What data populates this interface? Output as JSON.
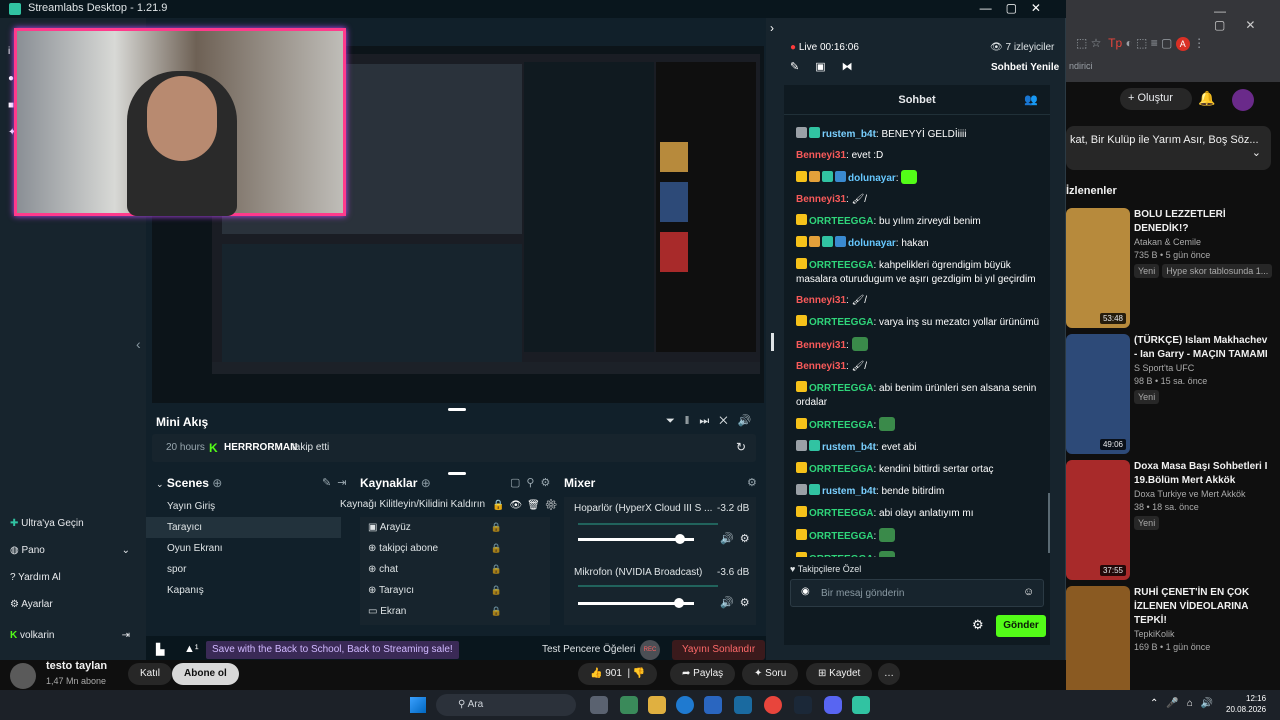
{
  "window": {
    "title": "Streamlabs Desktop - 1.21.9"
  },
  "stream": {
    "live_label": "Live 00:16:06",
    "viewers": "7 izleyiciler",
    "end_chat": "Sohbeti Yenile"
  },
  "chat": {
    "title": "Sohbet",
    "messages": [
      {
        "user": "rustem_b4t",
        "cls": "u-r",
        "text": "BENEYYİ GELDİiiii"
      },
      {
        "user": "Benneyi31",
        "cls": "u-b",
        "text": "evet :D"
      },
      {
        "user": "dolunayar",
        "cls": "u-d",
        "text": ""
      },
      {
        "user": "Benneyi31",
        "cls": "u-b",
        "text": "🖌/"
      },
      {
        "user": "ORRTEEGGA",
        "cls": "u-o",
        "text": "bu yılım zirveydi benim"
      },
      {
        "user": "dolunayar",
        "cls": "u-d",
        "text": "hakan"
      },
      {
        "user": "ORRTEEGGA",
        "cls": "u-o",
        "text": "kahpelikleri ögrendigim büyük masalara oturudugum ve aşırı gezdigim bi yıl geçirdim"
      },
      {
        "user": "Benneyi31",
        "cls": "u-b",
        "text": "🖌/"
      },
      {
        "user": "ORRTEEGGA",
        "cls": "u-o",
        "text": "varya inş su mezatcı yollar ürünümü"
      },
      {
        "user": "Benneyi31",
        "cls": "u-b",
        "text": ""
      },
      {
        "user": "Benneyi31",
        "cls": "u-b",
        "text": "🖌/"
      },
      {
        "user": "ORRTEEGGA",
        "cls": "u-o",
        "text": "abi benim ürünleri sen alsana senin ordalar"
      },
      {
        "user": "ORRTEEGGA",
        "cls": "u-o",
        "text": ""
      },
      {
        "user": "rustem_b4t",
        "cls": "u-r",
        "text": "evet abi"
      },
      {
        "user": "ORRTEEGGA",
        "cls": "u-o",
        "text": "kendini bittirdi sertar ortaç"
      },
      {
        "user": "rustem_b4t",
        "cls": "u-r",
        "text": "bende bitirdim"
      },
      {
        "user": "ORRTEEGGA",
        "cls": "u-o",
        "text": "abi olayı anlatıyım mı"
      },
      {
        "user": "ORRTEEGGA",
        "cls": "u-o",
        "text": ""
      },
      {
        "user": "ORRTEEGGA",
        "cls": "u-o",
        "text": ""
      }
    ],
    "followers_only": "Takipçilere Özel",
    "input_placeholder": "Bir mesaj gönderin",
    "send": "Gönder"
  },
  "mini": {
    "title": "Mini Akış",
    "time": "20 hours",
    "user": "HERRRORMAN",
    "action": "takip etti"
  },
  "scenes": {
    "title": "Scenes",
    "items": [
      "Yayın Giriş",
      "Tarayıcı",
      "Oyun Ekranı",
      "spor",
      "Kapanış"
    ]
  },
  "sources": {
    "title": "Kaynaklar",
    "tooltip": "Kaynağı Kilitleyin/Kilidini Kaldırın",
    "items": [
      "Arayüz",
      "takipçi abone",
      "chat",
      "Tarayıcı",
      "Ekran"
    ]
  },
  "mixer": {
    "title": "Mixer",
    "ch1": {
      "name": "Hoparlör (HyperX Cloud III S ...",
      "db": "-3.2 dB",
      "level": 0.88
    },
    "ch2": {
      "name": "Mikrofon (NVIDIA Broadcast)",
      "db": "-3.6 dB",
      "level": 0.87
    }
  },
  "sidebar": {
    "upgrade": "Ultra'ya Geçin",
    "dashboard": "Pano",
    "help": "Yardım Al",
    "settings": "Ayarlar",
    "user": "volkarin"
  },
  "bottom": {
    "promo": "Save with the Back to School, Back to Streaming sale!",
    "test": "Test Pencere Öğeleri",
    "rec": "REC",
    "end": "Yayını Sonlandır"
  },
  "youtube": {
    "create": "Oluştur",
    "banner": "kat, Bir Kulüp ile Yarım Asır, Boş Söz...",
    "related": "İzlenenler",
    "subtitle": "ndirici",
    "videos": [
      {
        "title": "BOLU LEZZETLERİ DENEDİK!?",
        "channel": "Atakan & Cemile",
        "meta": "735 B • 5 gün önce",
        "badge": "Yeni",
        "extra": "Hype skor tablosunda 1...",
        "dur": "53:48",
        "color": "#b78a3c"
      },
      {
        "title": "(TÜRKÇE) Islam Makhachev - Ian Garry - MAÇIN TAMAMI",
        "channel": "S Sport'ta UFC",
        "meta": "98 B • 15 sa. önce",
        "badge": "Yeni",
        "dur": "49:06",
        "color": "#2d4a78"
      },
      {
        "title": "Doxa Masa Başı Sohbetleri I 19.Bölüm Mert Akkök",
        "channel": "Doxa Turkiye ve Mert Akkök",
        "meta": "38 • 18 sa. önce",
        "badge": "Yeni",
        "dur": "37:55",
        "color": "#a82a2a"
      },
      {
        "title": "RUHİ ÇENET'İN EN ÇOK İZLENEN VİDEOLARINA TEPKİ!",
        "channel": "TepkiKolik",
        "meta": "169 B • 1 gün önce",
        "badge": "",
        "dur": "",
        "color": "#8a5a22"
      }
    ],
    "channel_name": "testo taylan",
    "subs": "1,47 Mn abone",
    "join": "Katıl",
    "subscribe": "Abone ol",
    "likes": "901",
    "share": "Paylaş",
    "ask": "Soru",
    "save": "Kaydet"
  },
  "taskbar": {
    "search": "Ara",
    "time": "12:16",
    "date": "20.08.2026"
  }
}
